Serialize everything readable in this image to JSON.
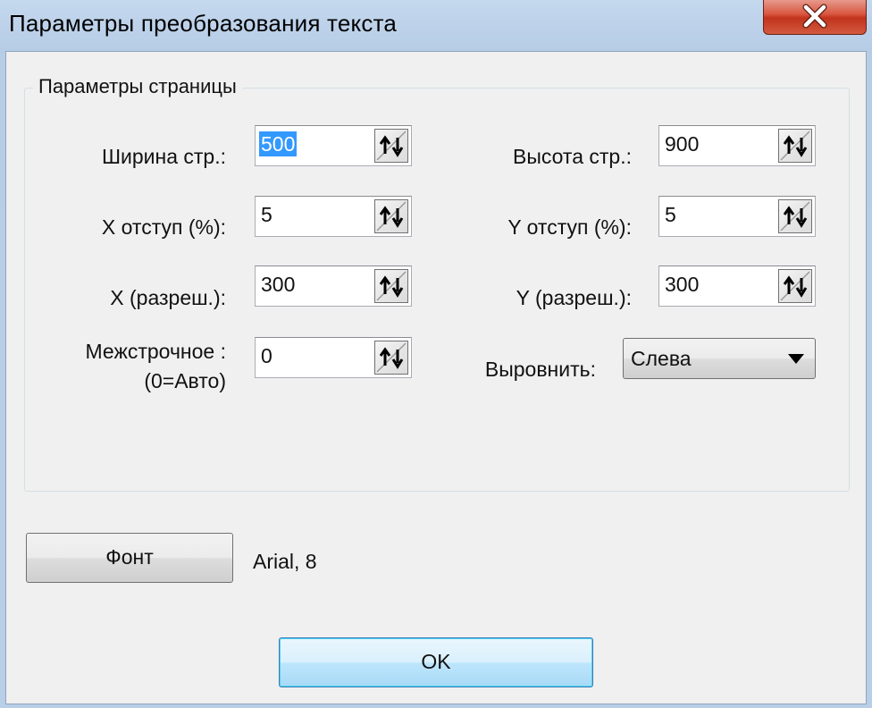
{
  "window": {
    "title": "Параметры преобразования текста"
  },
  "group": {
    "label": "Параметры страницы"
  },
  "fields": {
    "page_width": {
      "label": "Ширина стр.:",
      "value": "500"
    },
    "page_height": {
      "label": "Высота стр.:",
      "value": "900"
    },
    "x_margin": {
      "label": "X отступ (%):",
      "value": "5"
    },
    "y_margin": {
      "label": "Y отступ (%):",
      "value": "5"
    },
    "x_dpi": {
      "label": "X (разреш.):",
      "value": "300"
    },
    "y_dpi": {
      "label": "Y (разреш.):",
      "value": "300"
    },
    "line_spacing": {
      "label_line1": "Межстрочное :",
      "label_line2": "(0=Авто)",
      "value": "0"
    }
  },
  "align": {
    "label": "Выровнить:",
    "selected": "Слева"
  },
  "font": {
    "button_label": "Фонт",
    "current": "Arial, 8"
  },
  "ok": {
    "label": "OK"
  },
  "icons": {
    "close": "close-icon",
    "spin": "spin-arrows-icon",
    "dropdown": "dropdown-arrow-icon"
  },
  "colors": {
    "selection": "#3399ff",
    "close_button": "#c94a33",
    "ok_border": "#3c7fb1"
  }
}
